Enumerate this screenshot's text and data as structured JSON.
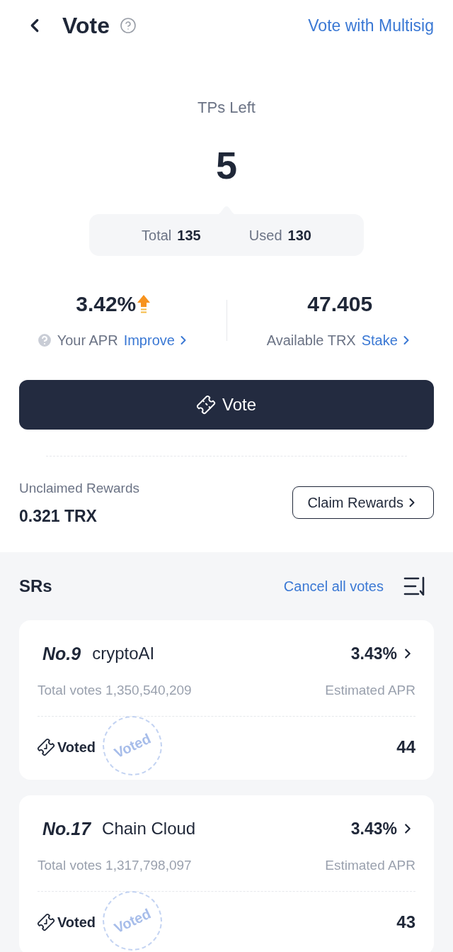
{
  "header": {
    "title": "Vote",
    "help": true,
    "multisig_link": "Vote with Multisig"
  },
  "tp_summary": {
    "label": "TPs Left",
    "value": "5",
    "total_label": "Total",
    "total": "135",
    "used_label": "Used",
    "used": "130"
  },
  "stats": [
    {
      "value": "3.42%",
      "rising": true,
      "help": true,
      "label": "Your APR",
      "link": "Improve"
    },
    {
      "value": "47.405",
      "rising": false,
      "help": false,
      "label": "Available TRX",
      "link": "Stake"
    }
  ],
  "vote_button": "Vote",
  "rewards": {
    "label": "Unclaimed Rewards",
    "amount": "0.321 TRX",
    "button": "Claim Rewards"
  },
  "srs": {
    "title": "SRs",
    "cancel_link": "Cancel all votes",
    "items": [
      {
        "rank": "No.9",
        "name": "cryptoAI",
        "apr": "3.43%",
        "total_votes": "Total votes 1,350,540,209",
        "apr_label": "Estimated APR",
        "voted": true,
        "status": "Voted",
        "votes": "44",
        "stamp": "Voted"
      },
      {
        "rank": "No.17",
        "name": "Chain Cloud",
        "apr": "3.43%",
        "total_votes": "Total votes 1,317,798,097",
        "apr_label": "Estimated APR",
        "voted": true,
        "status": "Voted",
        "votes": "43",
        "stamp": "Voted"
      }
    ]
  }
}
